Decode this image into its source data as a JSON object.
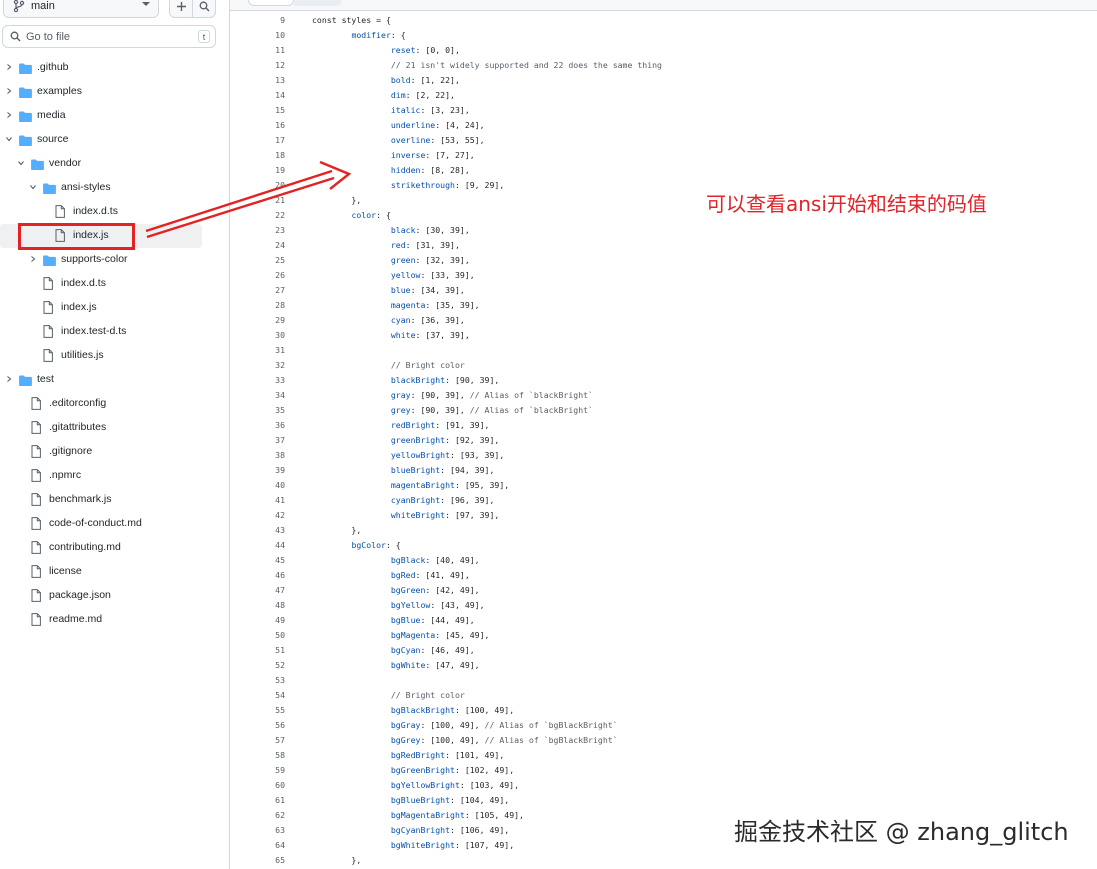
{
  "branch": {
    "name": "main"
  },
  "search": {
    "placeholder": "Go to file",
    "shortcut": "t"
  },
  "tree": [
    {
      "name": ".github",
      "type": "folder",
      "depth": 0,
      "state": "collapsed"
    },
    {
      "name": "examples",
      "type": "folder",
      "depth": 0,
      "state": "collapsed"
    },
    {
      "name": "media",
      "type": "folder",
      "depth": 0,
      "state": "collapsed"
    },
    {
      "name": "source",
      "type": "folder",
      "depth": 0,
      "state": "expanded"
    },
    {
      "name": "vendor",
      "type": "folder",
      "depth": 1,
      "state": "expanded"
    },
    {
      "name": "ansi-styles",
      "type": "folder",
      "depth": 2,
      "state": "expanded"
    },
    {
      "name": "index.d.ts",
      "type": "file",
      "depth": 3
    },
    {
      "name": "index.js",
      "type": "file",
      "depth": 3,
      "selected": true
    },
    {
      "name": "supports-color",
      "type": "folder",
      "depth": 2,
      "state": "collapsed"
    },
    {
      "name": "index.d.ts",
      "type": "file",
      "depth": 2
    },
    {
      "name": "index.js",
      "type": "file",
      "depth": 2
    },
    {
      "name": "index.test-d.ts",
      "type": "file",
      "depth": 2
    },
    {
      "name": "utilities.js",
      "type": "file",
      "depth": 2
    },
    {
      "name": "test",
      "type": "folder",
      "depth": 0,
      "state": "collapsed"
    },
    {
      "name": ".editorconfig",
      "type": "file",
      "depth": 1
    },
    {
      "name": ".gitattributes",
      "type": "file",
      "depth": 1
    },
    {
      "name": ".gitignore",
      "type": "file",
      "depth": 1
    },
    {
      "name": ".npmrc",
      "type": "file",
      "depth": 1
    },
    {
      "name": "benchmark.js",
      "type": "file",
      "depth": 1
    },
    {
      "name": "code-of-conduct.md",
      "type": "file",
      "depth": 1
    },
    {
      "name": "contributing.md",
      "type": "file",
      "depth": 1
    },
    {
      "name": "license",
      "type": "file",
      "depth": 1
    },
    {
      "name": "package.json",
      "type": "file",
      "depth": 1
    },
    {
      "name": "readme.md",
      "type": "file",
      "depth": 1
    }
  ],
  "code": [
    {
      "n": "9",
      "t": "const styles = {"
    },
    {
      "n": "10",
      "t": "\tmodifier: {"
    },
    {
      "n": "11",
      "t": "\t\treset: [0, 0],"
    },
    {
      "n": "12",
      "t": "\t\t// 21 isn't widely supported and 22 does the same thing"
    },
    {
      "n": "13",
      "t": "\t\tbold: [1, 22],"
    },
    {
      "n": "14",
      "t": "\t\tdim: [2, 22],"
    },
    {
      "n": "15",
      "t": "\t\titalic: [3, 23],"
    },
    {
      "n": "16",
      "t": "\t\tunderline: [4, 24],"
    },
    {
      "n": "17",
      "t": "\t\toverline: [53, 55],"
    },
    {
      "n": "18",
      "t": "\t\tinverse: [7, 27],"
    },
    {
      "n": "19",
      "t": "\t\thidden: [8, 28],"
    },
    {
      "n": "20",
      "t": "\t\tstrikethrough: [9, 29],"
    },
    {
      "n": "21",
      "t": "\t},"
    },
    {
      "n": "22",
      "t": "\tcolor: {"
    },
    {
      "n": "23",
      "t": "\t\tblack: [30, 39],"
    },
    {
      "n": "24",
      "t": "\t\tred: [31, 39],"
    },
    {
      "n": "25",
      "t": "\t\tgreen: [32, 39],"
    },
    {
      "n": "26",
      "t": "\t\tyellow: [33, 39],"
    },
    {
      "n": "27",
      "t": "\t\tblue: [34, 39],"
    },
    {
      "n": "28",
      "t": "\t\tmagenta: [35, 39],"
    },
    {
      "n": "29",
      "t": "\t\tcyan: [36, 39],"
    },
    {
      "n": "30",
      "t": "\t\twhite: [37, 39],"
    },
    {
      "n": "31",
      "t": ""
    },
    {
      "n": "32",
      "t": "\t\t// Bright color"
    },
    {
      "n": "33",
      "t": "\t\tblackBright: [90, 39],"
    },
    {
      "n": "34",
      "t": "\t\tgray: [90, 39], // Alias of `blackBright`"
    },
    {
      "n": "35",
      "t": "\t\tgrey: [90, 39], // Alias of `blackBright`"
    },
    {
      "n": "36",
      "t": "\t\tredBright: [91, 39],"
    },
    {
      "n": "37",
      "t": "\t\tgreenBright: [92, 39],"
    },
    {
      "n": "38",
      "t": "\t\tyellowBright: [93, 39],"
    },
    {
      "n": "39",
      "t": "\t\tblueBright: [94, 39],"
    },
    {
      "n": "40",
      "t": "\t\tmagentaBright: [95, 39],"
    },
    {
      "n": "41",
      "t": "\t\tcyanBright: [96, 39],"
    },
    {
      "n": "42",
      "t": "\t\twhiteBright: [97, 39],"
    },
    {
      "n": "43",
      "t": "\t},"
    },
    {
      "n": "44",
      "t": "\tbgColor: {"
    },
    {
      "n": "45",
      "t": "\t\tbgBlack: [40, 49],"
    },
    {
      "n": "46",
      "t": "\t\tbgRed: [41, 49],"
    },
    {
      "n": "47",
      "t": "\t\tbgGreen: [42, 49],"
    },
    {
      "n": "48",
      "t": "\t\tbgYellow: [43, 49],"
    },
    {
      "n": "49",
      "t": "\t\tbgBlue: [44, 49],"
    },
    {
      "n": "50",
      "t": "\t\tbgMagenta: [45, 49],"
    },
    {
      "n": "51",
      "t": "\t\tbgCyan: [46, 49],"
    },
    {
      "n": "52",
      "t": "\t\tbgWhite: [47, 49],"
    },
    {
      "n": "53",
      "t": ""
    },
    {
      "n": "54",
      "t": "\t\t// Bright color"
    },
    {
      "n": "55",
      "t": "\t\tbgBlackBright: [100, 49],"
    },
    {
      "n": "56",
      "t": "\t\tbgGray: [100, 49], // Alias of `bgBlackBright`"
    },
    {
      "n": "57",
      "t": "\t\tbgGrey: [100, 49], // Alias of `bgBlackBright`"
    },
    {
      "n": "58",
      "t": "\t\tbgRedBright: [101, 49],"
    },
    {
      "n": "59",
      "t": "\t\tbgGreenBright: [102, 49],"
    },
    {
      "n": "60",
      "t": "\t\tbgYellowBright: [103, 49],"
    },
    {
      "n": "61",
      "t": "\t\tbgBlueBright: [104, 49],"
    },
    {
      "n": "62",
      "t": "\t\tbgMagentaBright: [105, 49],"
    },
    {
      "n": "63",
      "t": "\t\tbgCyanBright: [106, 49],"
    },
    {
      "n": "64",
      "t": "\t\tbgWhiteBright: [107, 49],"
    },
    {
      "n": "65",
      "t": "\t},"
    }
  ],
  "annotation": "可以查看ansi开始和结束的码值",
  "watermark": "掘金技术社区 @ zhang_glitch",
  "colors": {
    "annotation_red": "#e0242a",
    "folder_blue": "#54aeff",
    "code_key_blue": "#0550ae",
    "comment_gray": "#57606a",
    "selected_row": "#eef0f2"
  },
  "icons": {
    "branch": "git-branch-icon",
    "add": "plus-icon",
    "search": "search-icon",
    "folder": "folder-icon",
    "file": "file-icon",
    "chevron_right": "chevron-right-icon",
    "chevron_down": "chevron-down-icon"
  }
}
